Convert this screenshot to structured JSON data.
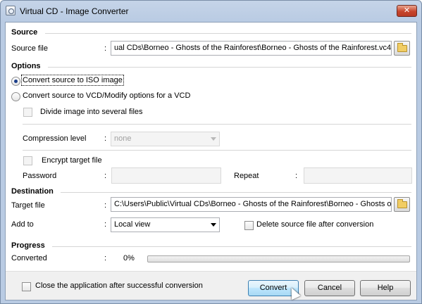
{
  "window": {
    "title": "Virtual CD - Image Converter",
    "close_label": "✕"
  },
  "source": {
    "section_title": "Source",
    "file_label": "Source file",
    "colon": ":",
    "file_value": "ual CDs\\Borneo - Ghosts of the Rainforest\\Borneo - Ghosts of the Rainforest.vc4"
  },
  "options": {
    "section_title": "Options",
    "iso_label": "Convert source to ISO image",
    "iso_checked": true,
    "vcd_label": "Convert source to VCD/Modify options for a VCD",
    "vcd_checked": false,
    "divide_label": "Divide image into several files",
    "compression_label": "Compression level",
    "compression_value": "none",
    "encrypt_label": "Encrypt target file",
    "password_label": "Password",
    "repeat_label": "Repeat"
  },
  "destination": {
    "section_title": "Destination",
    "target_label": "Target file",
    "target_value": "C:\\Users\\Public\\Virtual CDs\\Borneo - Ghosts of the Rainforest\\Borneo - Ghosts of the Rainforest.",
    "add_to_label": "Add to",
    "add_to_value": "Local view",
    "delete_label": "Delete source file after conversion"
  },
  "progress": {
    "section_title": "Progress",
    "converted_label": "Converted",
    "converted_value": "0%",
    "fraction": 0
  },
  "footer": {
    "close_app_label": "Close the application after successful conversion",
    "convert_label": "Convert",
    "cancel_label": "Cancel",
    "help_label": "Help"
  }
}
